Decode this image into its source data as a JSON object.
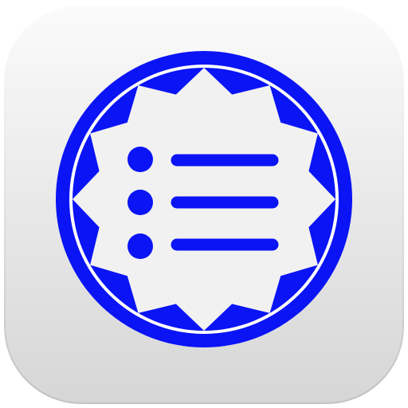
{
  "app_icon": {
    "icon_name": "list-app-icon",
    "glyph": "bulleted-list-icon",
    "badge_shape": "twelve-point-seal",
    "colors": {
      "accent": "#0A14F5",
      "tile_top": "#FBFBFB",
      "tile_bottom": "#D6D6D6",
      "badge_fill": "#F1F1F1",
      "ring_gap": "#FFFFFF"
    },
    "list_rows": 3
  }
}
